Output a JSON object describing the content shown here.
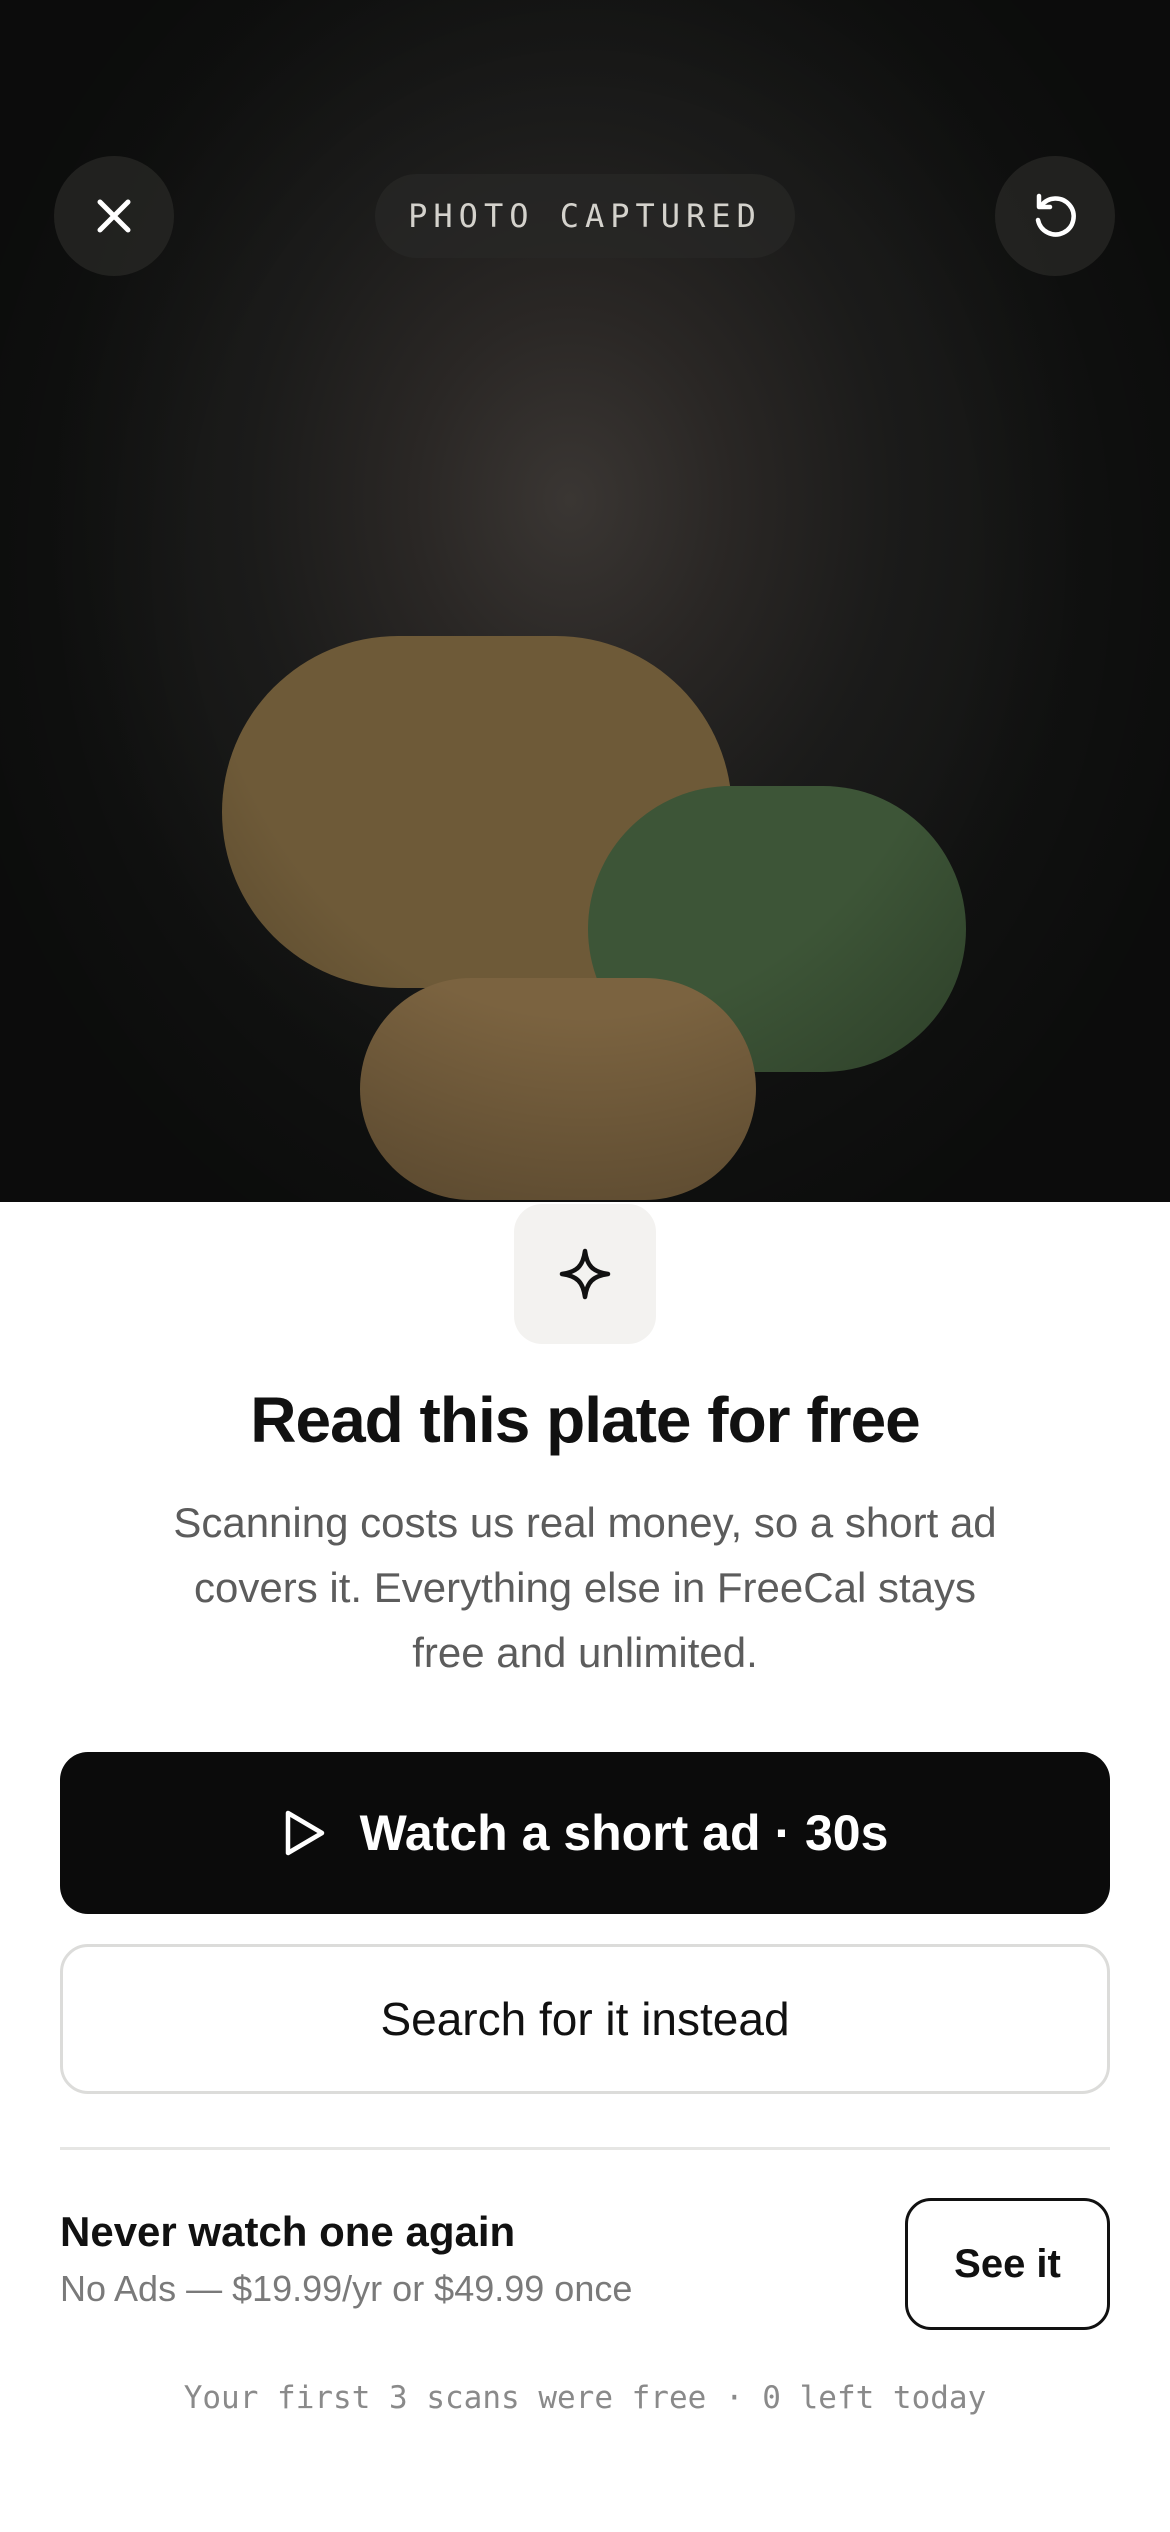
{
  "header": {
    "status": "PHOTO CAPTURED",
    "close_icon": "close-icon",
    "retake_icon": "retake-icon"
  },
  "prompt": {
    "icon": "sparkle-icon",
    "title": "Read this plate for free",
    "description": "Scanning costs us real money, so a short ad covers it. Everything else in FreeCal stays free and unlimited."
  },
  "actions": {
    "watch_icon": "play-icon",
    "watch_label": "Watch a short ad · 30s",
    "search_label": "Search for it instead"
  },
  "upsell": {
    "title": "Never watch one again",
    "subtitle": "No Ads — $19.99/yr or $49.99 once",
    "button_label": "See it"
  },
  "footer": {
    "note": "Your first 3 scans were free · 0 left today"
  },
  "colors": {
    "primary_button": "#0b0b0b",
    "food_brown": "#6e5a38",
    "food_green": "#3d5537",
    "food_tan": "#7b6340"
  }
}
